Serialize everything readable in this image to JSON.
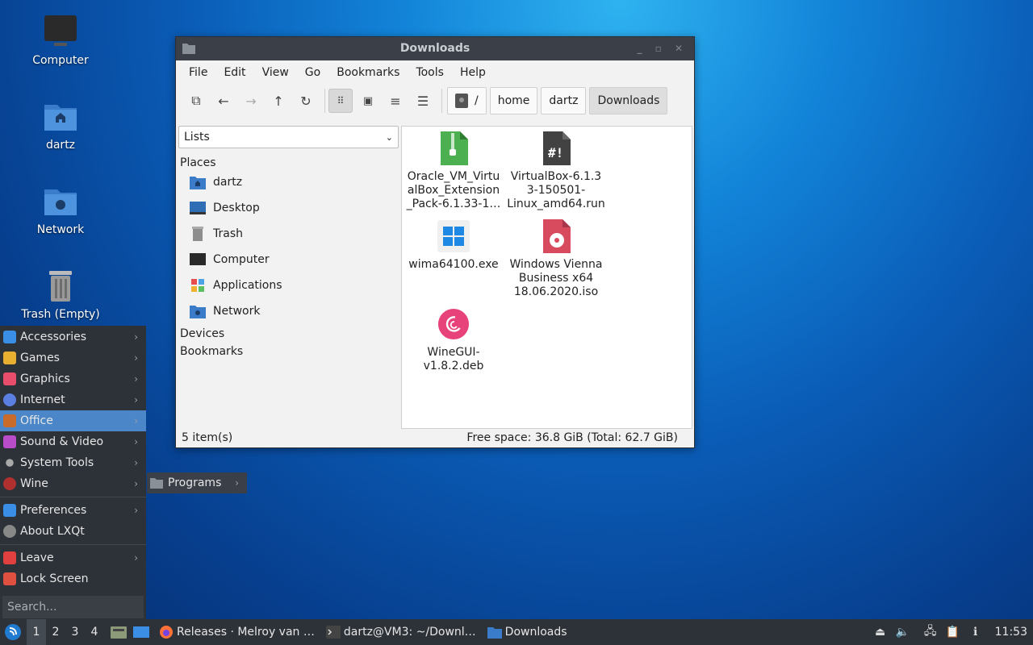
{
  "desktop": {
    "icons": [
      {
        "label": "Computer"
      },
      {
        "label": "dartz"
      },
      {
        "label": "Network"
      },
      {
        "label": "Trash (Empty)"
      }
    ]
  },
  "window": {
    "title": "Downloads",
    "menu": [
      "File",
      "Edit",
      "View",
      "Go",
      "Bookmarks",
      "Tools",
      "Help"
    ],
    "breadcrumb": [
      "/",
      "home",
      "dartz",
      "Downloads"
    ],
    "side_mode": "Lists",
    "places_heading": "Places",
    "places": [
      "dartz",
      "Desktop",
      "Trash",
      "Computer",
      "Applications",
      "Network"
    ],
    "devices_heading": "Devices",
    "bookmarks_heading": "Bookmarks",
    "files": [
      {
        "name_lines": [
          "Oracle_VM_Virtu",
          "alBox_Extension",
          "_Pack-6.1.33-1…"
        ],
        "icon": "archive-icon"
      },
      {
        "name_lines": [
          "VirtualBox-6.1.3",
          "3-150501-",
          "Linux_amd64.run"
        ],
        "icon": "script-icon"
      },
      {
        "name_lines": [
          "wima64100.exe"
        ],
        "icon": "windows-exe-icon"
      },
      {
        "name_lines": [
          "Windows Vienna",
          "Business x64",
          "18.06.2020.iso"
        ],
        "icon": "disc-image-icon"
      },
      {
        "name_lines": [
          "WineGUI-",
          "v1.8.2.deb"
        ],
        "icon": "debian-package-icon"
      }
    ],
    "status_left": "5 item(s)",
    "status_right": "Free space: 36.8 GiB (Total: 62.7 GiB)"
  },
  "start_menu": {
    "items": [
      {
        "label": "Accessories",
        "color": "#3a8ee6"
      },
      {
        "label": "Games",
        "color": "#e8b030"
      },
      {
        "label": "Graphics",
        "color": "#e84d6b"
      },
      {
        "label": "Internet",
        "color": "#5b7fe0"
      },
      {
        "label": "Office",
        "color": "#c96b2a"
      },
      {
        "label": "Sound & Video",
        "color": "#b94cc9"
      },
      {
        "label": "System Tools",
        "color": "#aaaaaa"
      },
      {
        "label": "Wine",
        "color": "#b03030"
      }
    ],
    "items2": [
      {
        "label": "Preferences",
        "color": "#3a8ee6"
      },
      {
        "label": "About LXQt",
        "color": "#888888"
      }
    ],
    "items3": [
      {
        "label": "Leave",
        "color": "#e04040"
      },
      {
        "label": "Lock Screen",
        "color": "#e05040"
      }
    ],
    "search_placeholder": "Search...",
    "submenu_label": "Programs"
  },
  "panel": {
    "workspaces": [
      "1",
      "2",
      "3",
      "4"
    ],
    "tasks": [
      "Releases · Melroy van …",
      "dartz@VM3: ~/Downl…",
      "Downloads"
    ],
    "clock": "11:53"
  }
}
